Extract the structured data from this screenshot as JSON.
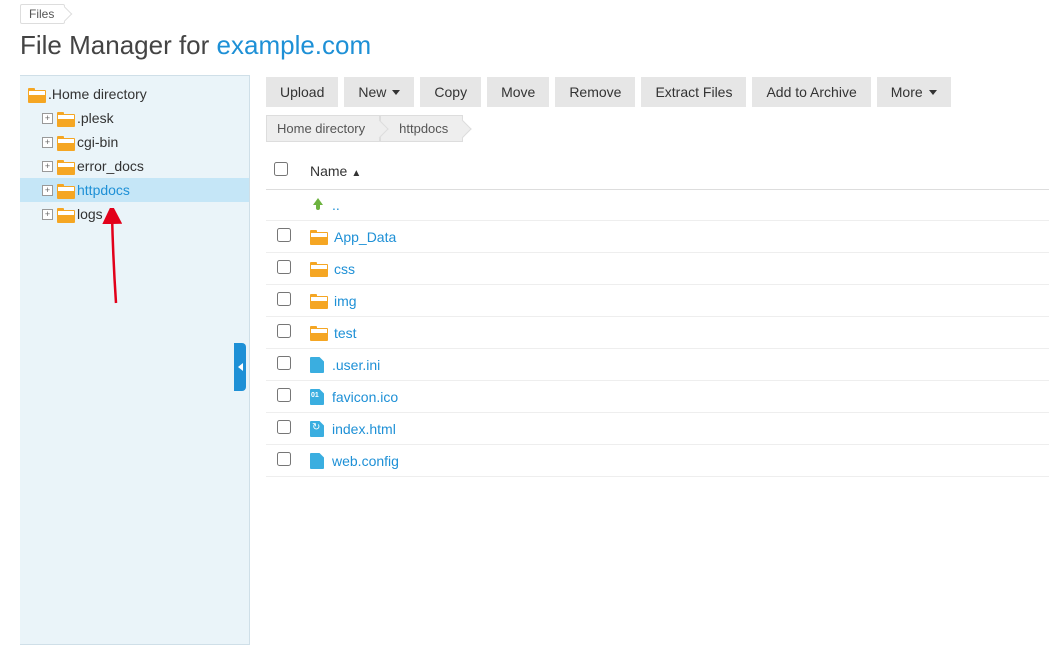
{
  "topCrumb": "Files",
  "title": {
    "prefix": "File Manager for ",
    "domain": "example.com"
  },
  "sidebar": {
    "root": ".Home directory",
    "items": [
      {
        "label": ".plesk"
      },
      {
        "label": "cgi-bin"
      },
      {
        "label": "error_docs"
      },
      {
        "label": "httpdocs",
        "selected": true
      },
      {
        "label": "logs"
      }
    ]
  },
  "toolbar": {
    "upload": "Upload",
    "new": "New",
    "copy": "Copy",
    "move": "Move",
    "remove": "Remove",
    "extract": "Extract Files",
    "archive": "Add to Archive",
    "more": "More"
  },
  "breadcrumb": [
    "Home directory",
    "httpdocs"
  ],
  "table": {
    "header": {
      "name": "Name"
    },
    "upLabel": "..",
    "rows": [
      {
        "type": "folder",
        "name": "App_Data"
      },
      {
        "type": "folder",
        "name": "css"
      },
      {
        "type": "folder",
        "name": "img"
      },
      {
        "type": "folder",
        "name": "test"
      },
      {
        "type": "file",
        "name": ".user.ini",
        "icon": "file"
      },
      {
        "type": "file",
        "name": "favicon.ico",
        "icon": "ico"
      },
      {
        "type": "file",
        "name": "index.html",
        "icon": "html"
      },
      {
        "type": "file",
        "name": "web.config",
        "icon": "file"
      }
    ]
  }
}
